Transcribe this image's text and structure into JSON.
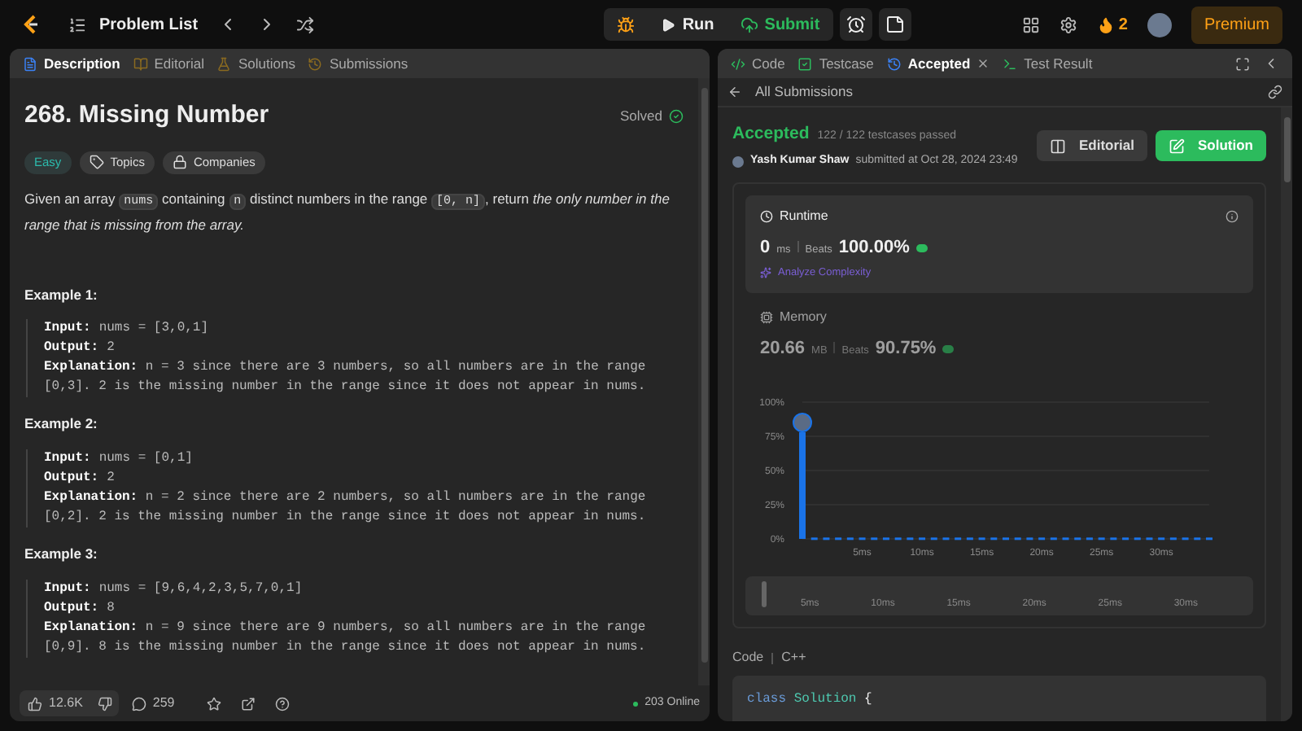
{
  "topbar": {
    "title": "Problem List",
    "run": "Run",
    "submit": "Submit",
    "streak": "2",
    "premium": "Premium"
  },
  "left_tabs": [
    {
      "label": "Description",
      "selected": true
    },
    {
      "label": "Editorial",
      "selected": false
    },
    {
      "label": "Solutions",
      "selected": false
    },
    {
      "label": "Submissions",
      "selected": false
    }
  ],
  "problem": {
    "title": "268. Missing Number",
    "status": "Solved",
    "tags": [
      {
        "label": "Easy",
        "kind": "difficulty"
      },
      {
        "label": "Topics",
        "kind": "topics"
      },
      {
        "label": "Companies",
        "kind": "companies"
      }
    ],
    "statement": [
      {
        "kind": "text",
        "text": "Given an array "
      },
      {
        "kind": "code",
        "text": "nums"
      },
      {
        "kind": "text",
        "text": " containing "
      },
      {
        "kind": "code",
        "text": "n"
      },
      {
        "kind": "text",
        "text": " distinct numbers in the range "
      },
      {
        "kind": "code",
        "text": "[0, n]"
      },
      {
        "kind": "text",
        "text": ", return "
      },
      {
        "kind": "em",
        "text": "the only number in the range that is missing from the array."
      }
    ],
    "examples": [
      {
        "heading": "Example 1:",
        "input_label": "Input:",
        "input": "nums = [3,0,1]",
        "output_label": "Output:",
        "output": "2",
        "explanation_label": "Explanation:",
        "explanation": "n = 3 since there are 3 numbers, so all numbers are in the range [0,3]. 2 is the missing number in the range since it does not appear in nums."
      },
      {
        "heading": "Example 2:",
        "input_label": "Input:",
        "input": "nums = [0,1]",
        "output_label": "Output:",
        "output": "2",
        "explanation_label": "Explanation:",
        "explanation": "n = 2 since there are 2 numbers, so all numbers are in the range [0,2]. 2 is the missing number in the range since it does not appear in nums."
      },
      {
        "heading": "Example 3:",
        "input_label": "Input:",
        "input": "nums = [9,6,4,2,3,5,7,0,1]",
        "output_label": "Output:",
        "output": "8",
        "explanation_label": "Explanation:",
        "explanation": "n = 9 since there are 9 numbers, so all numbers are in the range [0,9]. 8 is the missing number in the range since it does not appear in nums."
      }
    ]
  },
  "left_footer": {
    "likes": "12.6K",
    "comments": "259",
    "online": "203 Online"
  },
  "right_tabs": [
    {
      "label": "Code",
      "selected": false
    },
    {
      "label": "Testcase",
      "selected": false
    },
    {
      "label": "Accepted",
      "selected": true,
      "closable": true
    },
    {
      "label": "Test Result",
      "selected": false
    }
  ],
  "submission": {
    "back": "All Submissions",
    "verdict": "Accepted",
    "passed": "122 / 122 testcases passed",
    "user": "Yash Kumar Shaw",
    "submitted": "submitted at Oct 28, 2024 23:49",
    "editorial": "Editorial",
    "solution": "Solution",
    "runtime": {
      "label": "Runtime",
      "value": "0",
      "unit": "ms",
      "beats_label": "Beats",
      "beats": "100.00%",
      "analyze": "Analyze Complexity",
      "selected": true
    },
    "memory": {
      "label": "Memory",
      "value": "20.66",
      "unit": "MB",
      "beats_label": "Beats",
      "beats": "90.75%",
      "selected": false
    },
    "chart_data": {
      "type": "bar",
      "x": [
        0,
        1,
        2,
        3,
        4,
        5,
        6,
        7,
        8,
        9,
        10,
        11,
        12,
        13,
        14,
        15,
        16,
        17,
        18,
        19,
        20,
        21,
        22,
        23,
        24,
        25,
        26,
        27,
        28,
        29,
        30,
        31,
        32,
        33,
        34
      ],
      "xlim": [
        0,
        34
      ],
      "grid": true,
      "series": [
        {
          "color": "#1a73e8",
          "values": [
            78,
            1,
            1,
            1,
            1,
            1,
            1,
            1,
            1,
            1,
            1,
            1,
            1,
            1,
            1,
            1,
            1,
            1,
            1,
            1,
            1,
            1,
            1,
            1,
            1,
            1,
            1,
            1,
            1,
            1,
            1,
            1,
            1,
            1,
            1
          ]
        }
      ],
      "ylim": [
        0,
        100
      ],
      "yticks": [
        {
          "value": 0,
          "label": "0%"
        },
        {
          "value": 25,
          "label": "25%"
        },
        {
          "value": 50,
          "label": "50%"
        },
        {
          "value": 75,
          "label": "75%"
        },
        {
          "value": 100,
          "label": "100%"
        }
      ],
      "xticks": [
        {
          "value": 5,
          "label": "5ms"
        },
        {
          "value": 10,
          "label": "10ms"
        },
        {
          "value": 15,
          "label": "15ms"
        },
        {
          "value": 20,
          "label": "20ms"
        },
        {
          "value": 25,
          "label": "25ms"
        },
        {
          "value": 30,
          "label": "30ms"
        }
      ]
    },
    "minimap_labels": [
      "5ms",
      "10ms",
      "15ms",
      "20ms",
      "25ms",
      "30ms"
    ],
    "code_label": "Code",
    "language": "C++",
    "code_keyword": "class",
    "code_name": "Solution",
    "code_brace": "{"
  }
}
